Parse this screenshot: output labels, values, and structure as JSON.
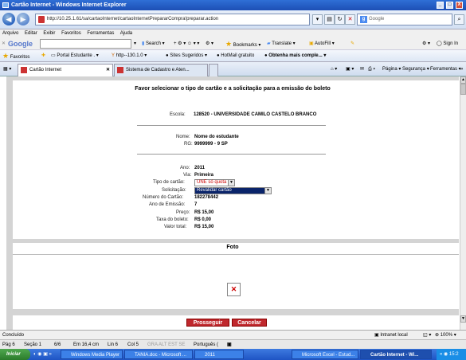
{
  "window": {
    "title": "Cartão Internet - Windows Internet Explorer",
    "controls": [
      "_",
      "□",
      "X"
    ]
  },
  "addressbar": {
    "url": "http://10.25.1.61/sa/cartaoInternet/cartaoInternetPrepararCompra!preparar.action",
    "search_placeholder": "Google"
  },
  "menu": [
    "Arquivo",
    "Editar",
    "Exibir",
    "Favoritos",
    "Ferramentas",
    "Ajuda"
  ],
  "google_toolbar": {
    "logo": "Google",
    "search": "Search",
    "bookmarks": "Bookmarks",
    "translate": "Translate",
    "autofill": "AutoFill",
    "signin": "Sign In"
  },
  "favorites_bar": {
    "favorites": "Favoritos",
    "items": [
      "Portal Estudante .",
      "http--130.1.0",
      "Sites Sugeridos",
      "HotMail gratuito",
      "Obtenha mais comple..."
    ]
  },
  "tabs": [
    {
      "label": "Cartão Internet",
      "active": true
    },
    {
      "label": "Sistema de Cadastro e Aten...",
      "active": false
    }
  ],
  "tab_tools": {
    "page": "Página",
    "security": "Segurança",
    "tools": "Ferramentas"
  },
  "page": {
    "header": "Favor selecionar o tipo de cartão e a solicitação para a emissão do boleto",
    "escola_label": "Escola:",
    "escola_value": "128520 - UNIVERSIDADE CAMILO CASTELO BRANCO",
    "nome_label": "Nome:",
    "nome_value": "Nome do estudante",
    "rg_label": "RG:",
    "rg_value": "9999999 - 9 SP",
    "ano_label": "Ano:",
    "ano_value": "2011",
    "via_label": "Via:",
    "via_value": "Primeira",
    "tipo_label": "Tipo de cartão:",
    "tipo_value": "UNE só quota",
    "solicitacao_label": "Solicitação:",
    "solicitacao_value": "Revalidar cartão",
    "numero_label": "Número do Cartão:",
    "numero_value": "182278442",
    "emissao_label": "Ano de Emissão:",
    "emissao_value": "7",
    "preco_label": "Preço:",
    "preco_value": "R$ 15,00",
    "taxa_label": "Taxa do boleto:",
    "taxa_value": "R$ 0,00",
    "total_label": "Valor total:",
    "total_value": "R$ 15,00",
    "foto_header": "Foto",
    "prosseguir": "Prosseguir",
    "cancelar": "Cancelar"
  },
  "status": {
    "text": "Concluído",
    "zone": "Intranet local",
    "zoom": "100%"
  },
  "word_status": {
    "page": "Pág 6",
    "section": "Seção 1",
    "pages": "6/6",
    "position": "Em 16,4 cm",
    "line": "Lin 6",
    "col": "Col 5",
    "modes": "GRA  ALT  EST  SE",
    "language": "Português ("
  },
  "taskbar": {
    "start": "Iniciar",
    "items": [
      "Windows Media Player",
      "TANIA.doc - Microsoft ...",
      "2011",
      "Microsoft Excel - Estud...",
      "Cartão Internet - Wi..."
    ],
    "clock": "15:2"
  }
}
